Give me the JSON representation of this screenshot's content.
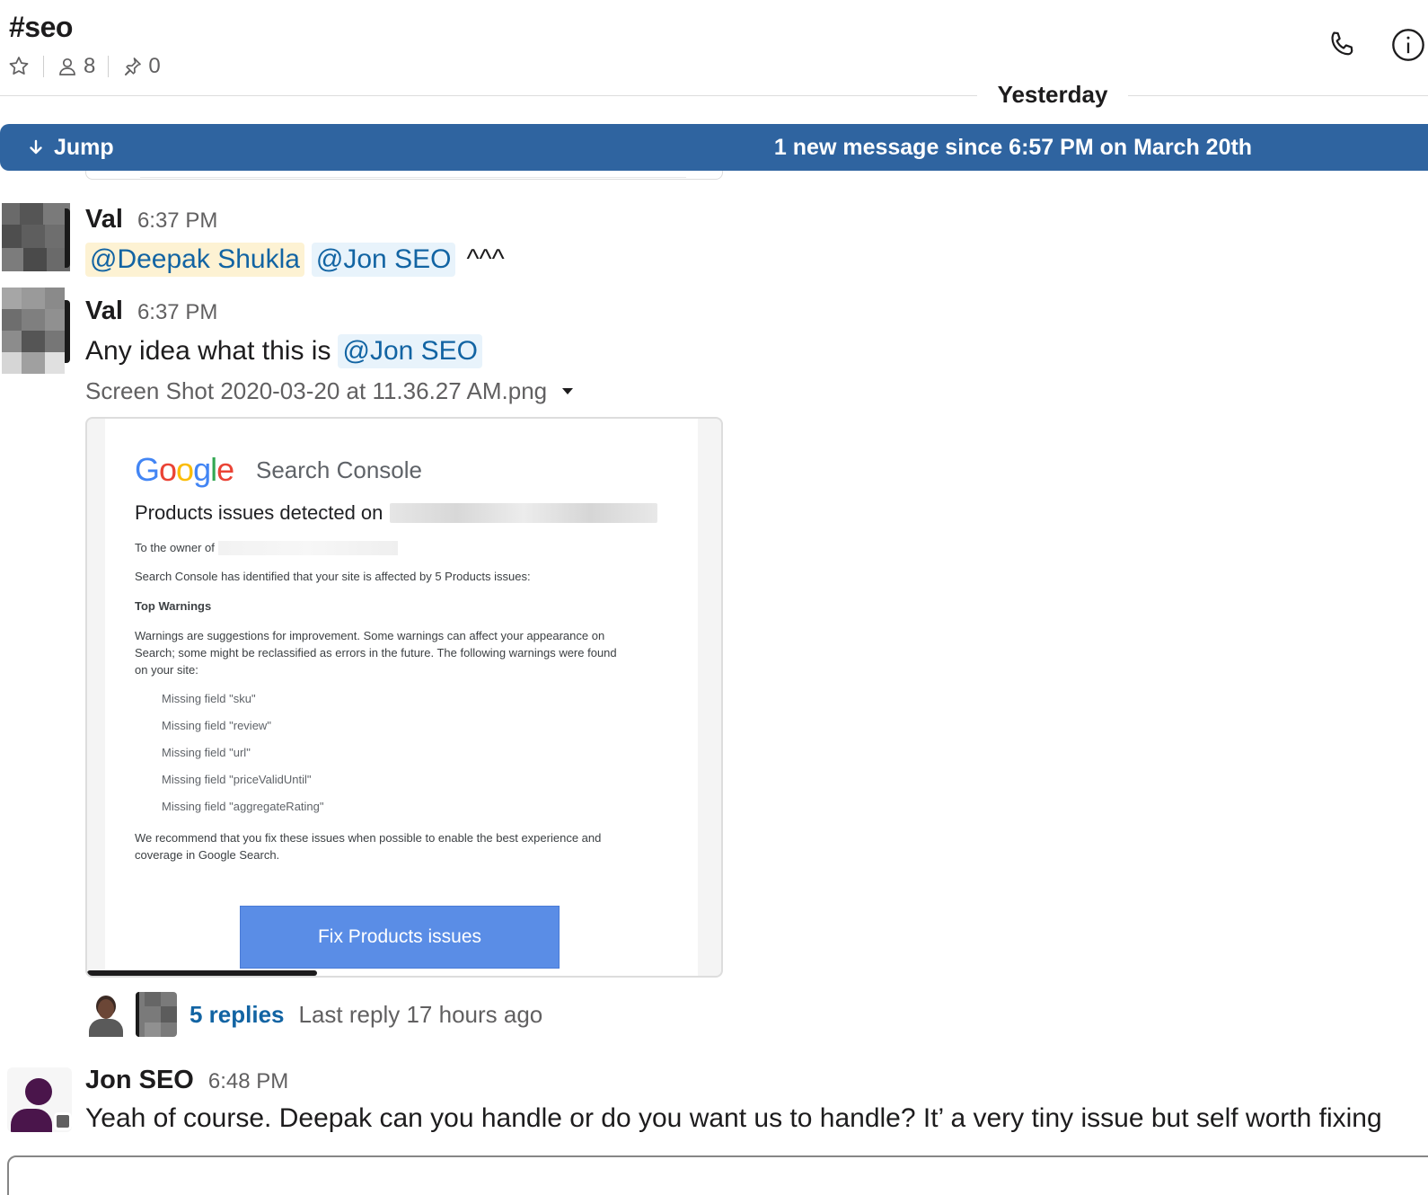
{
  "channel": {
    "name": "#seo",
    "member_count": "8",
    "pinned_count": "0"
  },
  "day_divider": "Yesterday",
  "jump_bar": {
    "jump_label": "Jump",
    "new_message_text": "1 new message since 6:57 PM on March 20th"
  },
  "messages": [
    {
      "author": "Val",
      "time": "6:37 PM",
      "mentions": [
        "@Deepak Shukla",
        "@Jon SEO"
      ],
      "suffix": "^^^"
    },
    {
      "author": "Val",
      "time": "6:37 PM",
      "text": "Any idea what this is",
      "mention": "@Jon SEO",
      "file_name": "Screen Shot 2020-03-20 at 11.36.27 AM.png",
      "attachment": {
        "logo": "Google",
        "product": "Search Console",
        "title": "Products issues detected on",
        "owner_line": "To the owner of",
        "summary": "Search Console has identified that your site is affected by 5 Products issues:",
        "heading": "Top Warnings",
        "warning_text_1": "Warnings are suggestions for improvement. Some warnings can affect your appearance on",
        "warning_text_2": "Search; some might be reclassified as errors in the future. The following warnings were found",
        "warning_text_3": "on your site:",
        "issues": [
          "Missing field \"sku\"",
          "Missing field \"review\"",
          "Missing field \"url\"",
          "Missing field \"priceValidUntil\"",
          "Missing field \"aggregateRating\""
        ],
        "recommend_1": "We recommend that you fix these issues when possible to enable the best experience and",
        "recommend_2": "coverage in Google Search.",
        "button": "Fix Products issues"
      },
      "thread": {
        "replies": "5 replies",
        "last_reply": "Last reply 17 hours ago"
      }
    },
    {
      "author": "Jon SEO",
      "time": "6:48 PM",
      "text": "Yeah of course. Deepak can you handle or do you want us to handle? It’ a very tiny issue but self worth fixing"
    }
  ],
  "colors": {
    "jump_bar": "#2f64a0",
    "mention_text": "#1264a3",
    "mention_bg": "#e8f3fb",
    "mention_self_bg": "#fdf2d3",
    "gsc_button": "#5a8de6",
    "jon_avatar": "#4a154b"
  },
  "icons": {
    "star": "star-icon",
    "members": "person-icon",
    "pins": "pin-icon",
    "call": "phone-icon",
    "info": "info-icon",
    "jump": "arrow-down-icon",
    "file_menu": "caret-down-icon"
  }
}
